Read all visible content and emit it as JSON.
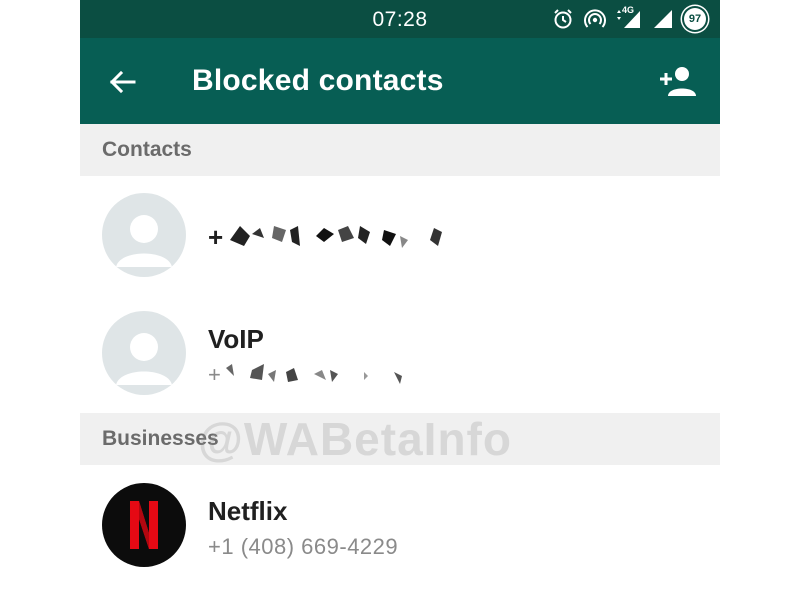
{
  "status_bar": {
    "time": "07:28",
    "network": "4G",
    "battery": "97",
    "icons": [
      "alarm-icon",
      "hotspot-icon",
      "signal-icon",
      "signal-icon",
      "battery-icon"
    ]
  },
  "app_bar": {
    "title": "Blocked contacts",
    "back_icon": "arrow-back-icon",
    "add_icon": "add-person-icon"
  },
  "sections": {
    "contacts_header": "Contacts",
    "businesses_header": "Businesses"
  },
  "contacts": [
    {
      "title_prefix": "+",
      "redacted": true
    },
    {
      "title": "VoIP",
      "subtitle_prefix": "+",
      "redacted": true
    }
  ],
  "businesses": [
    {
      "name": "Netflix",
      "phone": "+1 (408) 669-4229",
      "logo_letter": "N"
    }
  ],
  "watermark": "@WABetaInfo",
  "colors": {
    "status_bar": "#0b4e42",
    "app_bar": "#075e54",
    "section_bg": "#f0f0f0",
    "netflix_red": "#e50914"
  }
}
